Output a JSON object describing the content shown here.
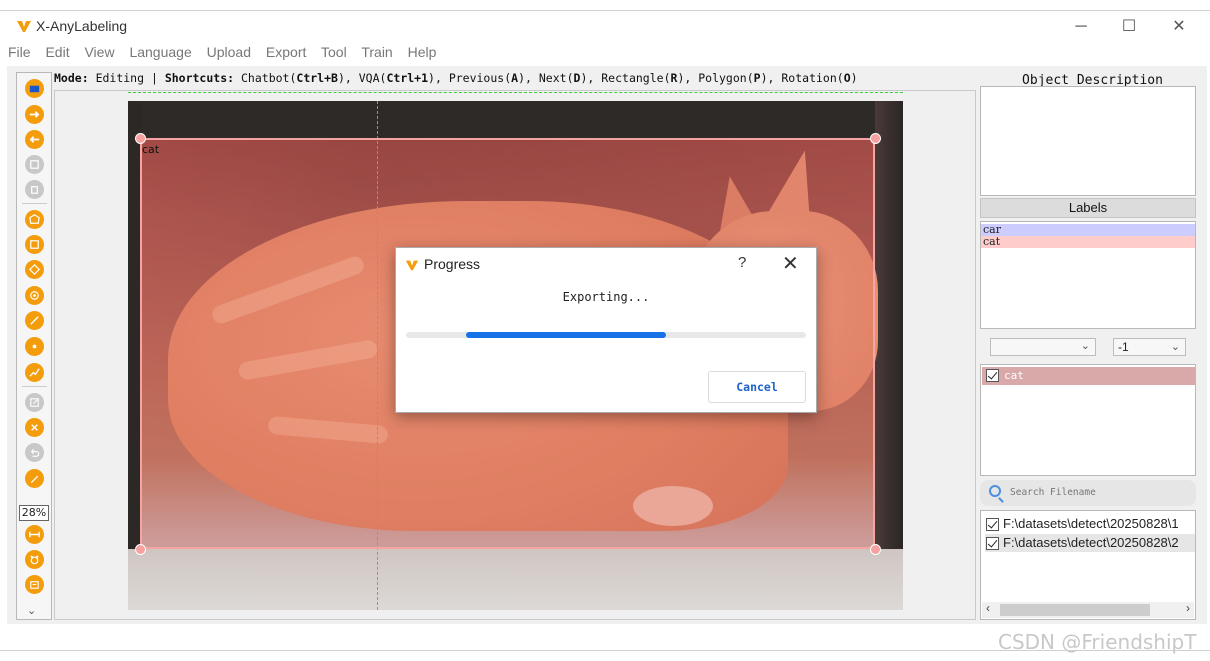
{
  "window": {
    "title": "X-AnyLabeling",
    "minimize_glyph": "─",
    "maximize_glyph": "☐",
    "close_glyph": "✕",
    "accent": "#f39c0c"
  },
  "menu": [
    "File",
    "Edit",
    "View",
    "Language",
    "Upload",
    "Export",
    "Tool",
    "Train",
    "Help"
  ],
  "toolbar": {
    "zoom": "28%",
    "more_glyph": "⌄",
    "icons": [
      "open-folder-icon",
      "next-image-icon",
      "previous-image-icon",
      "save-icon",
      "delete-file-icon",
      "polygon-icon",
      "rectangle-icon",
      "rotation-icon",
      "circle-icon",
      "line-icon",
      "point-icon",
      "linestrip-icon",
      "edit-icon",
      "delete-shape-icon",
      "undo-icon",
      "brush-icon",
      "fit-width-icon",
      "auto-label-icon",
      "ai-icon"
    ]
  },
  "modebar": {
    "mode_label": "Mode:",
    "mode_value": "Editing",
    "shortcuts_label": "Shortcuts:",
    "shortcuts": [
      {
        "name": "Chatbot",
        "key": "Ctrl+B"
      },
      {
        "name": "VQA",
        "key": "Ctrl+1"
      },
      {
        "name": "Previous",
        "key": "A"
      },
      {
        "name": "Next",
        "key": "D"
      },
      {
        "name": "Rectangle",
        "key": "R"
      },
      {
        "name": "Polygon",
        "key": "P"
      },
      {
        "name": "Rotation",
        "key": "O"
      }
    ]
  },
  "canvas": {
    "shape_label": "cat"
  },
  "progress_dialog": {
    "title": "Progress",
    "help_glyph": "?",
    "close_glyph": "✕",
    "message": "Exporting...",
    "progress_start": 0.15,
    "progress_end": 0.65,
    "cancel_label": "Cancel",
    "bar_color": "#1672e6"
  },
  "right_panel": {
    "object_description_title": "Object Description",
    "labels_title": "Labels",
    "labels": [
      {
        "name": "car",
        "color": "#ccccff"
      },
      {
        "name": "cat",
        "color": "#ffcccc"
      }
    ],
    "group_select_value": "",
    "group_id_value": "-1",
    "shapes": [
      {
        "label": "cat",
        "checked": true
      }
    ],
    "search_placeholder": "Search Filename",
    "files": [
      {
        "path": "F:\\datasets\\detect\\20250828\\1",
        "checked": true
      },
      {
        "path": "F:\\datasets\\detect\\20250828\\2",
        "checked": true
      }
    ]
  },
  "watermark": "CSDN @FriendshipT"
}
